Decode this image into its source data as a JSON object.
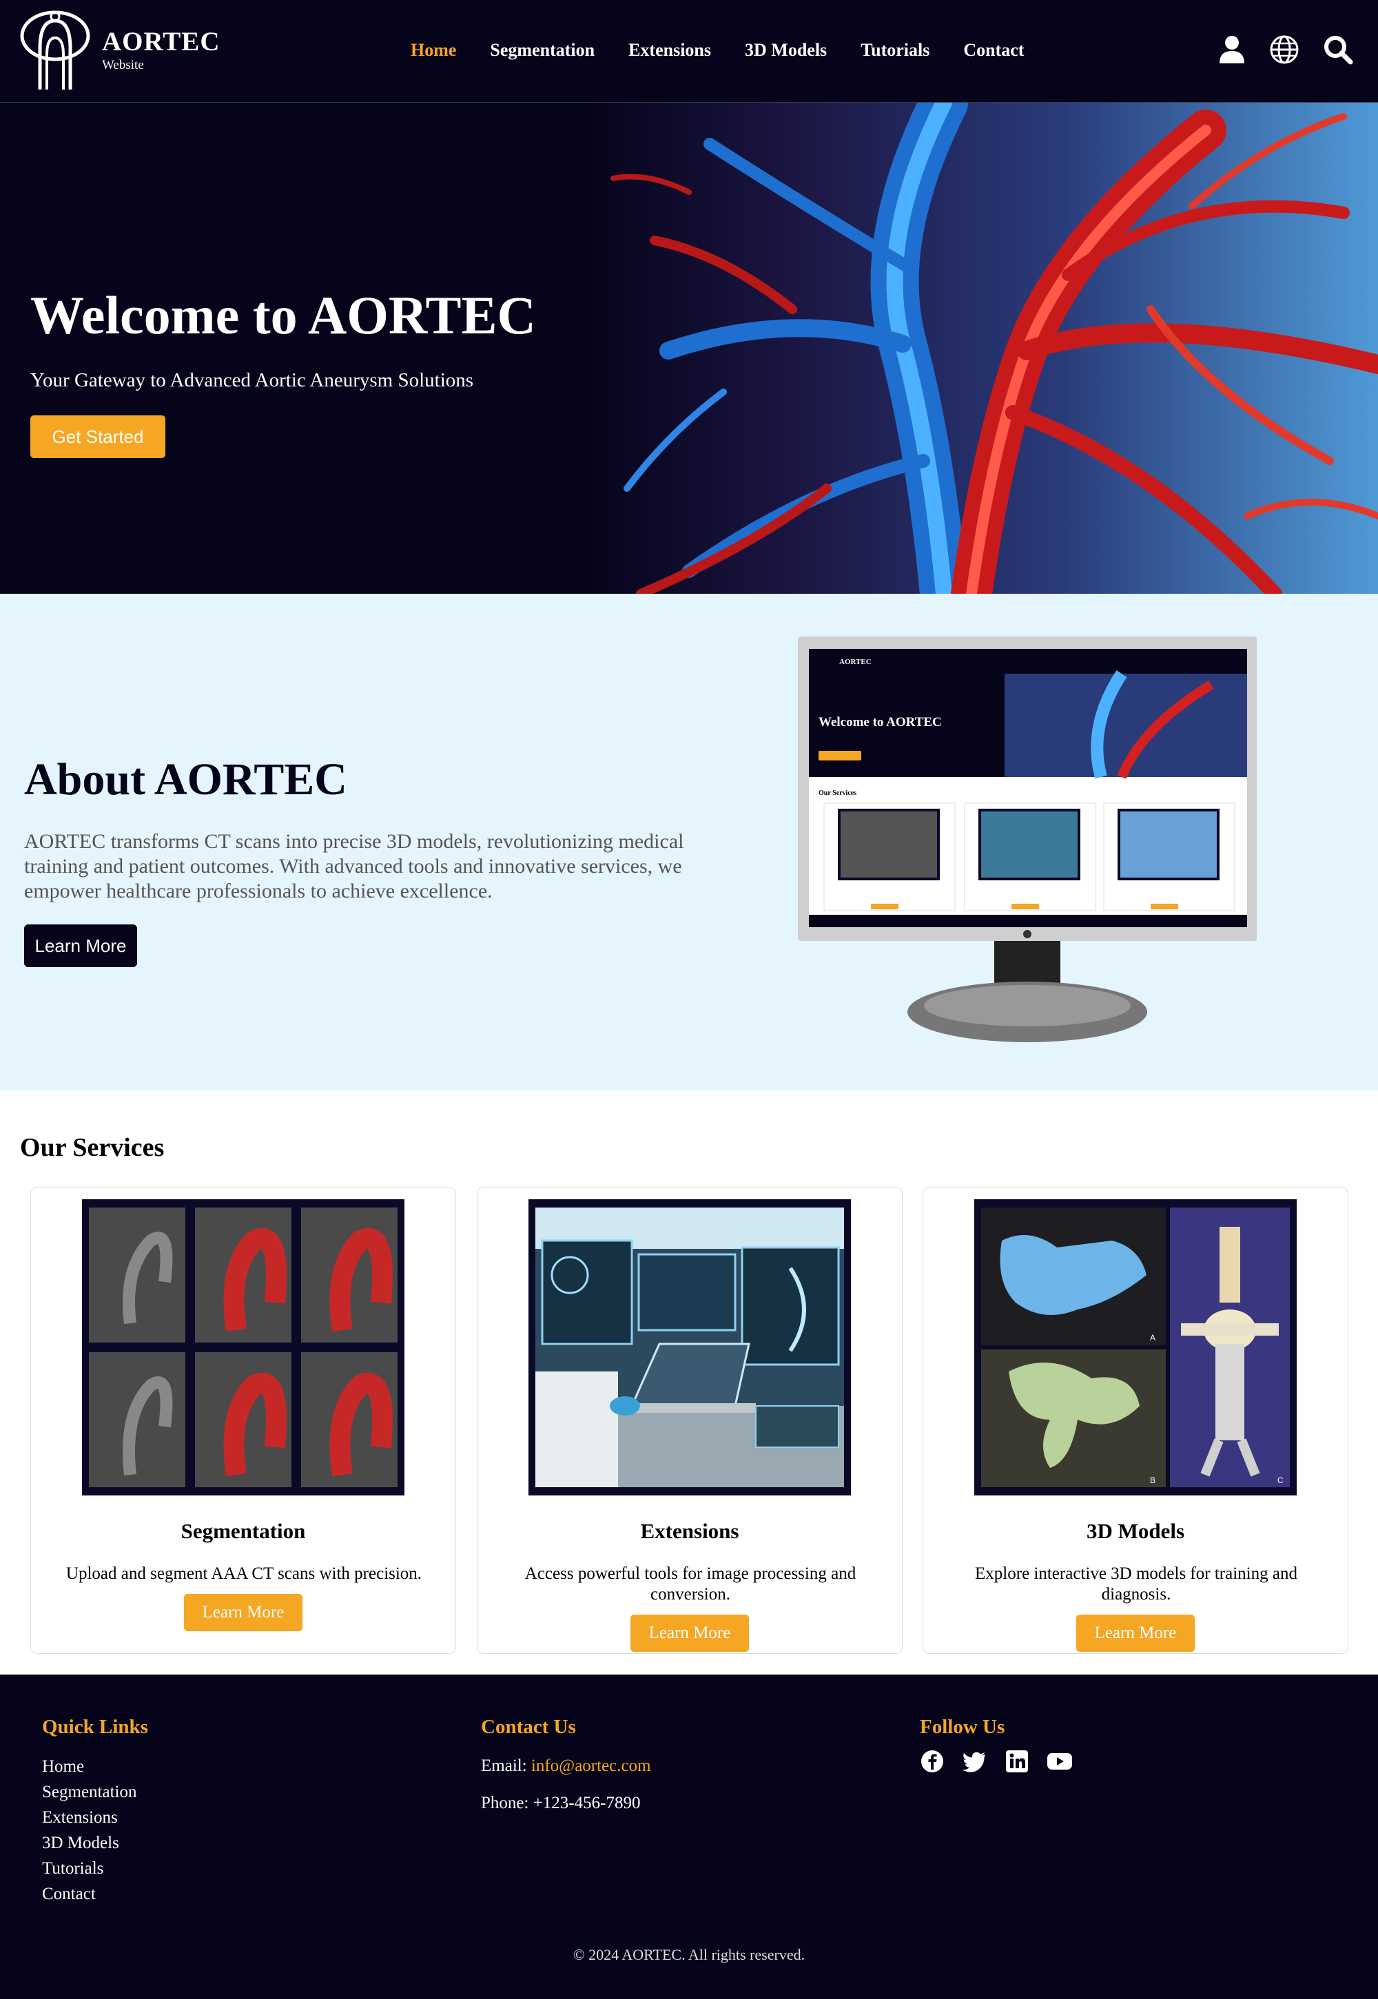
{
  "header": {
    "brand_name": "AORTEC",
    "brand_sub": "Website",
    "nav": [
      {
        "label": "Home",
        "active": true
      },
      {
        "label": "Segmentation"
      },
      {
        "label": "Extensions"
      },
      {
        "label": "3D Models"
      },
      {
        "label": "Tutorials"
      },
      {
        "label": "Contact"
      }
    ],
    "icons": [
      "user-icon",
      "globe-icon",
      "search-icon"
    ],
    "accent": "#f5a623",
    "background": "#05041a"
  },
  "hero": {
    "title": "Welcome to AORTEC",
    "subtitle": "Your Gateway to Advanced Aortic Aneurysm Solutions",
    "cta_label": "Get Started"
  },
  "about": {
    "title": "About AORTEC",
    "text": "AORTEC transforms CT scans into precise 3D models, revolutionizing medical training and patient outcomes. With advanced tools and innovative services, we empower healthcare professionals to achieve excellence.",
    "cta_label": "Learn More",
    "background": "#e4f5fd"
  },
  "services": {
    "title": "Our Services",
    "cards": [
      {
        "title": "Segmentation",
        "text": "Upload and segment AAA CT scans with precision.",
        "button": "Learn More"
      },
      {
        "title": "Extensions",
        "text": "Access powerful tools for image processing and conversion.",
        "button": "Learn More"
      },
      {
        "title": "3D Models",
        "text": "Explore interactive 3D models for training and diagnosis.",
        "button": "Learn More"
      }
    ]
  },
  "footer": {
    "quick_links_title": "Quick Links",
    "links": [
      "Home",
      "Segmentation",
      "Extensions",
      "3D Models",
      "Tutorials",
      "Contact"
    ],
    "contact_title": "Contact Us",
    "email_label": "Email:",
    "email": "info@aortec.com",
    "phone_label": "Phone:",
    "phone": "+123-456-7890",
    "follow_title": "Follow Us",
    "social_icons": [
      "facebook-icon",
      "twitter-icon",
      "linkedin-icon",
      "youtube-icon"
    ],
    "copyright": "© 2024 AORTEC. All rights reserved."
  }
}
